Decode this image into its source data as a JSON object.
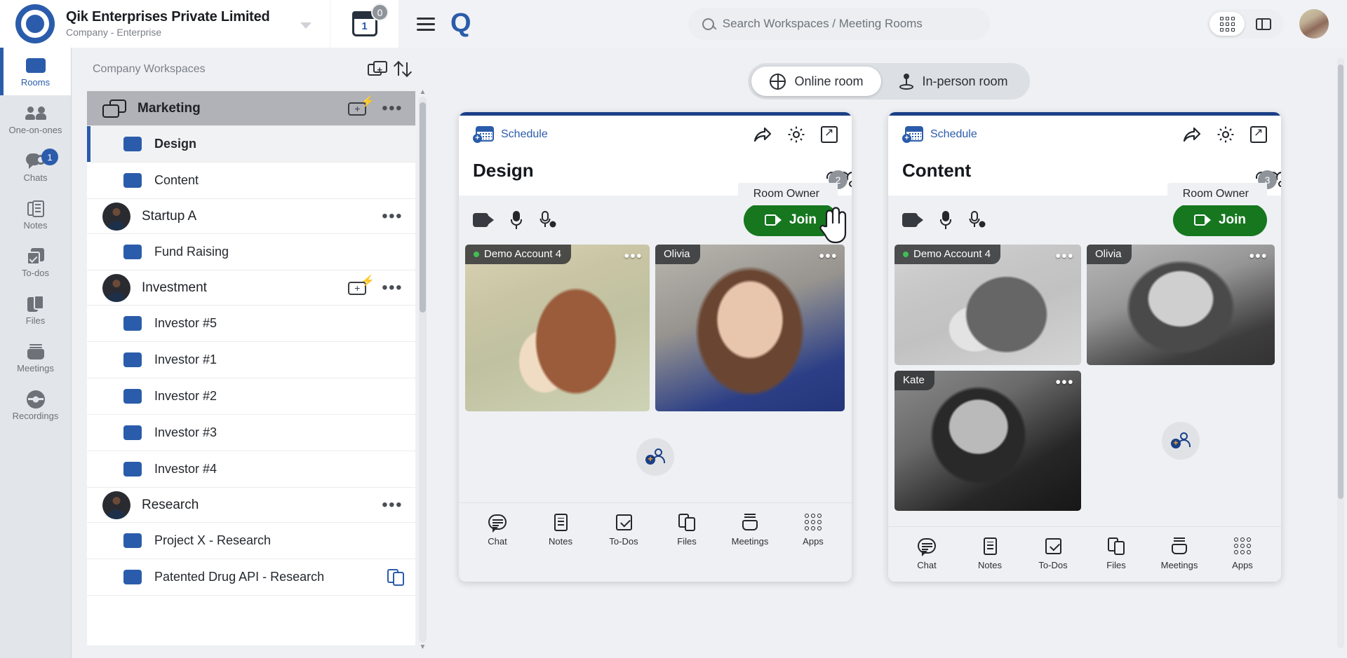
{
  "topbar": {
    "company_name": "Qik Enterprises Private Limited",
    "company_sub": "Company - Enterprise",
    "calendar_day": "1",
    "calendar_badge": "0",
    "logo_label": "qik-logo",
    "search": {
      "placeholder": "Search Workspaces / Meeting Rooms",
      "value": ""
    },
    "view_grid_label": "grid-view",
    "view_split_label": "split-view"
  },
  "rail": {
    "items": [
      {
        "label": "Rooms",
        "icon": "rooms-icon",
        "active": true,
        "badge": ""
      },
      {
        "label": "One-on-ones",
        "icon": "people-icon",
        "active": false,
        "badge": ""
      },
      {
        "label": "Chats",
        "icon": "chat-icon",
        "active": false,
        "badge": "1"
      },
      {
        "label": "Notes",
        "icon": "notes-icon",
        "active": false,
        "badge": ""
      },
      {
        "label": "To-dos",
        "icon": "todo-icon",
        "active": false,
        "badge": ""
      },
      {
        "label": "Files",
        "icon": "files-icon",
        "active": false,
        "badge": ""
      },
      {
        "label": "Meetings",
        "icon": "meetings-icon",
        "active": false,
        "badge": ""
      },
      {
        "label": "Recordings",
        "icon": "recordings-icon",
        "active": false,
        "badge": ""
      }
    ]
  },
  "workspaces": {
    "header": "Company Workspaces",
    "add_icon": "add-workspace-icon",
    "sort_icon": "sort-icon",
    "groups": [
      {
        "name": "Marketing",
        "type": "folder",
        "selected": true,
        "has_add": true,
        "has_more": true,
        "rooms": [
          {
            "name": "Design",
            "active": true
          },
          {
            "name": "Content",
            "active": false
          }
        ]
      },
      {
        "name": "Startup A",
        "type": "avatar",
        "selected": false,
        "has_add": false,
        "has_more": true,
        "rooms": [
          {
            "name": "Fund Raising",
            "active": false
          }
        ]
      },
      {
        "name": "Investment",
        "type": "avatar",
        "selected": false,
        "has_add": true,
        "has_more": true,
        "rooms": [
          {
            "name": "Investor #5",
            "active": false
          },
          {
            "name": "Investor #1",
            "active": false
          },
          {
            "name": "Investor #2",
            "active": false
          },
          {
            "name": "Investor #3",
            "active": false
          },
          {
            "name": "Investor #4",
            "active": false
          }
        ]
      },
      {
        "name": "Research",
        "type": "avatar",
        "selected": false,
        "has_add": false,
        "has_more": true,
        "rooms": [
          {
            "name": "Project X - Research",
            "active": false
          },
          {
            "name": "Patented Drug API - Research",
            "active": false,
            "copy": true
          }
        ]
      }
    ]
  },
  "main": {
    "tabs": [
      {
        "label": "Online room",
        "icon": "globe-icon",
        "active": true
      },
      {
        "label": "In-person room",
        "icon": "location-pin-icon",
        "active": false
      }
    ],
    "footer_items": [
      {
        "label": "Chat",
        "icon": "chat-icon"
      },
      {
        "label": "Notes",
        "icon": "notes-icon"
      },
      {
        "label": "To-Dos",
        "icon": "todo-icon"
      },
      {
        "label": "Files",
        "icon": "files-icon"
      },
      {
        "label": "Meetings",
        "icon": "meetings-icon"
      },
      {
        "label": "Apps",
        "icon": "apps-icon"
      }
    ],
    "cards": [
      {
        "schedule_label": "Schedule",
        "title": "Design",
        "member_count": "2",
        "tooltip": "Room Owner",
        "join_label": "Join",
        "share_icon": "share-icon",
        "settings_icon": "gear-icon",
        "popout_icon": "open-in-new-icon",
        "participants": [
          {
            "name": "Demo Account 4",
            "online": true,
            "photo": "ph-girl"
          },
          {
            "name": "Olivia",
            "online": false,
            "photo": "ph-olivia"
          }
        ]
      },
      {
        "schedule_label": "Schedule",
        "title": "Content",
        "member_count": "3",
        "tooltip": "Room Owner",
        "join_label": "Join",
        "share_icon": "share-icon",
        "settings_icon": "gear-icon",
        "popout_icon": "open-in-new-icon",
        "participants": [
          {
            "name": "Demo Account 4",
            "online": true,
            "photo": "ph-girl"
          },
          {
            "name": "Olivia",
            "online": false,
            "photo": "ph-olivia"
          },
          {
            "name": "Kate",
            "online": false,
            "photo": "ph-kate"
          }
        ]
      }
    ]
  },
  "colors": {
    "brand": "#2b5cab",
    "join_green": "#16771f",
    "card_top": "#1b3f87",
    "badge_gray": "#8f949b"
  }
}
